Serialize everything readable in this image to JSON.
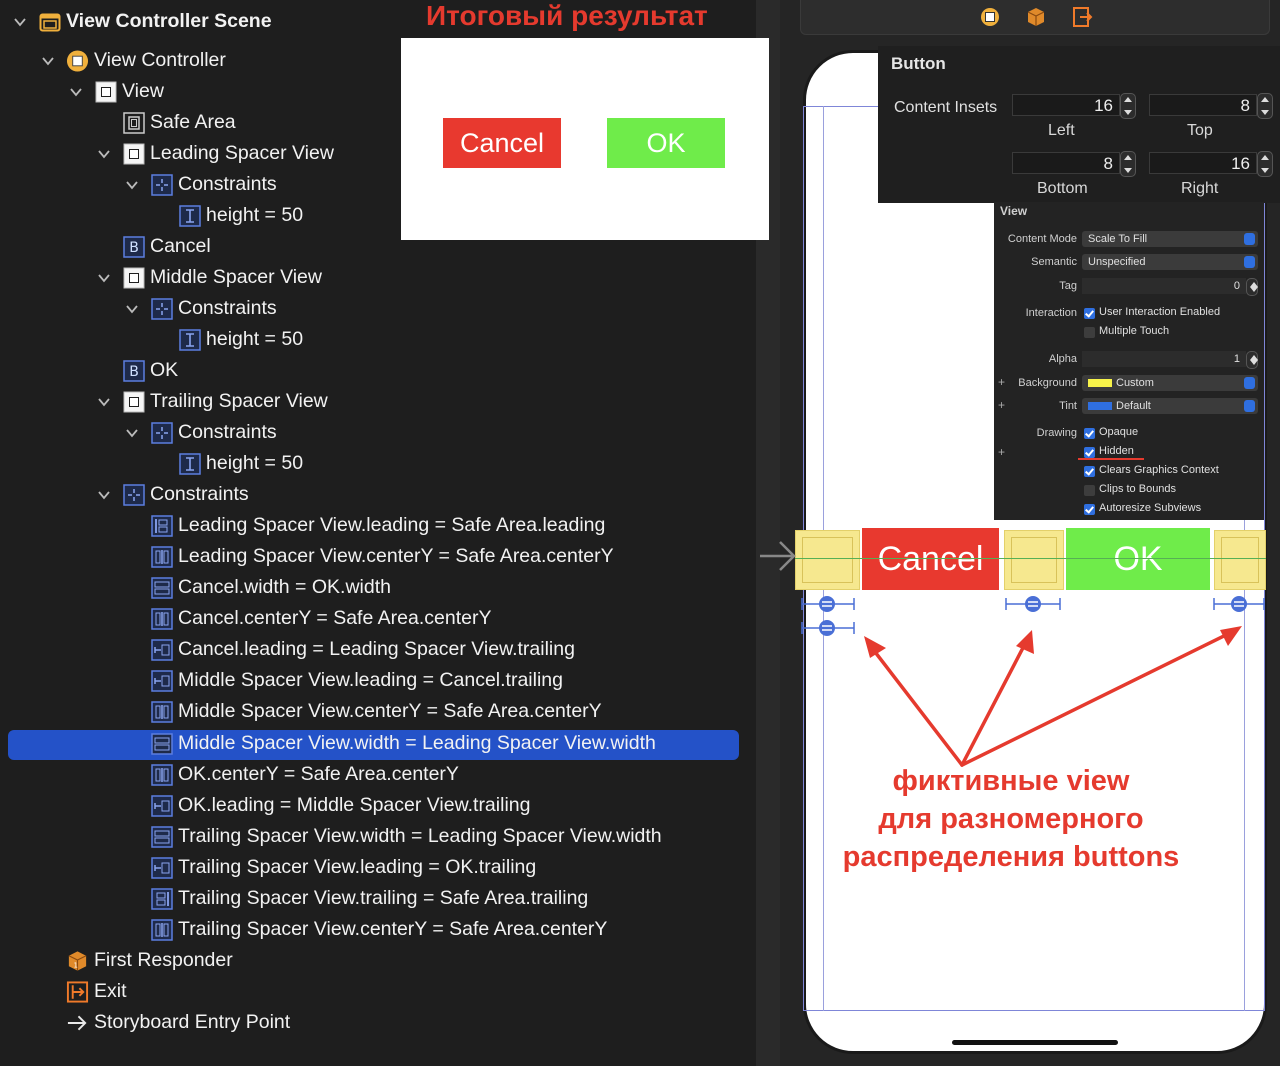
{
  "outline": {
    "scene_title": "View Controller Scene",
    "items": [
      {
        "label": "View Controller"
      },
      {
        "label": "View"
      },
      {
        "label": "Safe Area"
      },
      {
        "label": "Leading Spacer View"
      },
      {
        "label": "Constraints"
      },
      {
        "label": "height = 50"
      },
      {
        "label": "Cancel"
      },
      {
        "label": "Middle Spacer View"
      },
      {
        "label": "Constraints"
      },
      {
        "label": "height = 50"
      },
      {
        "label": "OK"
      },
      {
        "label": "Trailing Spacer View"
      },
      {
        "label": "Constraints"
      },
      {
        "label": "height = 50"
      },
      {
        "label": "Constraints"
      },
      {
        "label": "Leading Spacer View.leading = Safe Area.leading"
      },
      {
        "label": "Leading Spacer View.centerY = Safe Area.centerY"
      },
      {
        "label": "Cancel.width = OK.width"
      },
      {
        "label": "Cancel.centerY = Safe Area.centerY"
      },
      {
        "label": "Cancel.leading = Leading Spacer View.trailing"
      },
      {
        "label": "Middle Spacer View.leading = Cancel.trailing"
      },
      {
        "label": "Middle Spacer View.centerY = Safe Area.centerY"
      },
      {
        "label": "Middle Spacer View.width = Leading Spacer View.width"
      },
      {
        "label": "OK.centerY = Safe Area.centerY"
      },
      {
        "label": "OK.leading = Middle Spacer View.trailing"
      },
      {
        "label": "Trailing Spacer View.width = Leading Spacer View.width"
      },
      {
        "label": "Trailing Spacer View.leading = OK.trailing"
      },
      {
        "label": "Trailing Spacer View.trailing = Safe Area.trailing"
      },
      {
        "label": "Trailing Spacer View.centerY = Safe Area.centerY"
      },
      {
        "label": "First Responder"
      },
      {
        "label": "Exit"
      },
      {
        "label": "Storyboard Entry Point"
      }
    ]
  },
  "result": {
    "title": "Итоговый результат",
    "cancel_label": "Cancel",
    "ok_label": "OK"
  },
  "inspector": {
    "section_title": "Button",
    "content_insets_label": "Content Insets",
    "left_value": "16",
    "left_label": "Left",
    "top_value": "8",
    "top_label": "Top",
    "bottom_value": "8",
    "bottom_label": "Bottom",
    "right_value": "16",
    "right_label": "Right"
  },
  "view_inspector": {
    "section_title": "View",
    "content_mode_label": "Content Mode",
    "content_mode_value": "Scale To Fill",
    "semantic_label": "Semantic",
    "semantic_value": "Unspecified",
    "tag_label": "Tag",
    "tag_value": "0",
    "interaction_label": "Interaction",
    "user_interaction": "User Interaction Enabled",
    "multiple_touch": "Multiple Touch",
    "alpha_label": "Alpha",
    "alpha_value": "1",
    "background_label": "Background",
    "background_value": "Custom",
    "tint_label": "Tint",
    "tint_value": "Default",
    "drawing_label": "Drawing",
    "opaque": "Opaque",
    "hidden": "Hidden",
    "clears_graphics": "Clears Graphics Context",
    "clips_to_bounds": "Clips to Bounds",
    "autoresize": "Autoresize Subviews",
    "background_color": "#f7f34a",
    "tint_color": "#2f6fe0"
  },
  "canvas": {
    "cancel_label": "Cancel",
    "ok_label": "OK",
    "annotation_lines": [
      "фиктивные view",
      "для разномерного",
      "распределения buttons"
    ]
  },
  "colors": {
    "cancel_red": "#e8392f",
    "ok_green": "#6fec4a",
    "spacer_yellow": "#f6e88f",
    "selection_blue": "#2452c8",
    "annotation_red": "#e53a2e"
  }
}
